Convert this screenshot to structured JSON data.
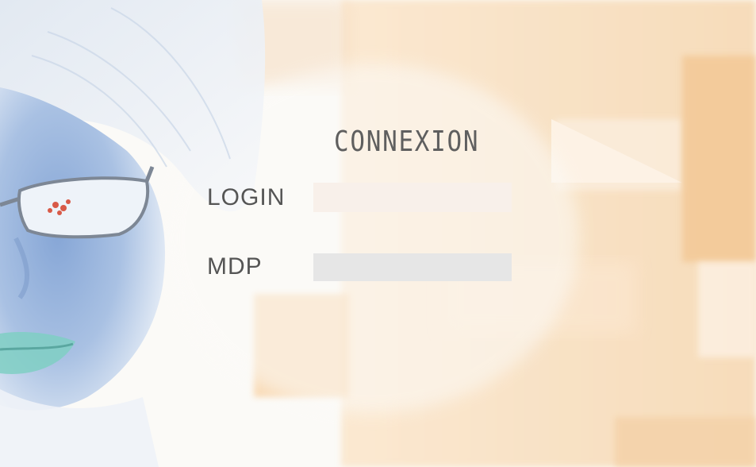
{
  "form": {
    "title": "CONNEXION",
    "login_label": "LOGIN",
    "login_value": "",
    "password_label": "MDP",
    "password_value": ""
  },
  "colors": {
    "background": "#fbfaf7",
    "accent_orange": "#f6d4a9",
    "face_blue": "#6f93c9",
    "title_text": "#5f5f5f",
    "login_field_bg": "#f8f0ea",
    "password_field_bg": "#e6e6e6"
  }
}
